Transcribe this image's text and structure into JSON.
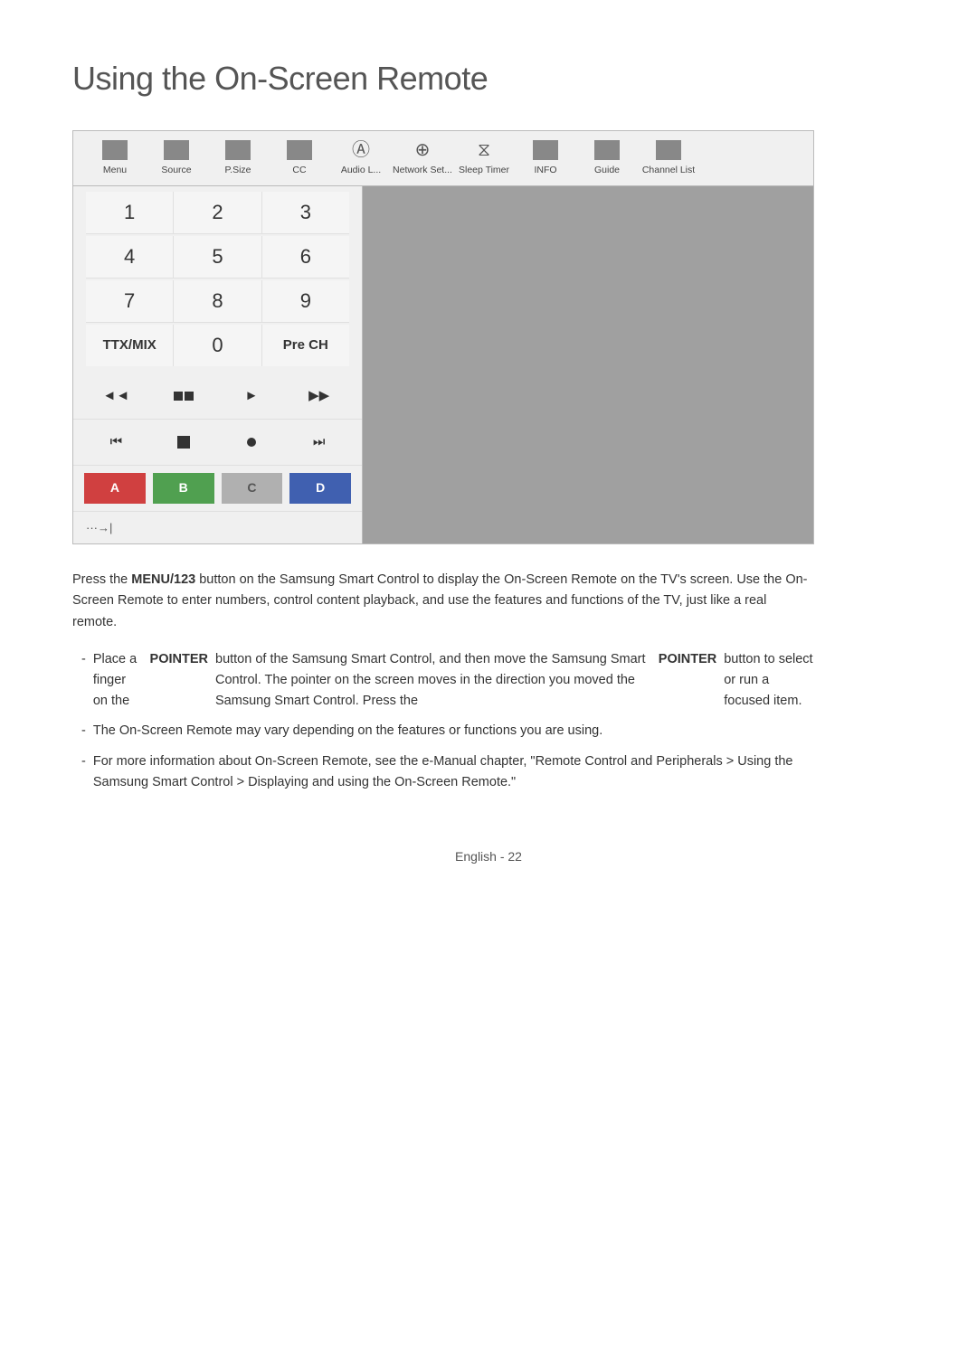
{
  "title": "Using the On-Screen Remote",
  "toolbar": {
    "items": [
      {
        "label": "Menu",
        "icon_type": "square"
      },
      {
        "label": "Source",
        "icon_type": "square"
      },
      {
        "label": "P.Size",
        "icon_type": "square"
      },
      {
        "label": "CC",
        "icon_type": "square"
      },
      {
        "label": "Audio L...",
        "icon_type": "letter_a"
      },
      {
        "label": "Network Set...",
        "icon_type": "globe"
      },
      {
        "label": "Sleep Timer",
        "icon_type": "clock"
      },
      {
        "label": "INFO",
        "icon_type": "square"
      },
      {
        "label": "Guide",
        "icon_type": "square"
      },
      {
        "label": "Channel List",
        "icon_type": "square"
      }
    ]
  },
  "numpad": {
    "rows": [
      [
        "1",
        "2",
        "3"
      ],
      [
        "4",
        "5",
        "6"
      ],
      [
        "7",
        "8",
        "9"
      ],
      [
        "TTX/MIX",
        "0",
        "Pre CH"
      ]
    ]
  },
  "transport_row1": [
    "◄◄",
    "▐▐",
    "►",
    "►►"
  ],
  "transport_row2": [
    "◄◄◄",
    "■",
    "●",
    "►►►"
  ],
  "color_buttons": [
    "A",
    "B",
    "C",
    "D"
  ],
  "nav_label": "···→|",
  "description": "Press the MENU/123 button on the Samsung Smart Control to display the On-Screen Remote on the TV's screen. Use the On-Screen Remote to enter numbers, control content playback, and use the features and functions of the TV, just like a real remote.",
  "bullets": [
    "Place a finger on the POINTER button of the Samsung Smart Control, and then move the Samsung Smart Control. The pointer on the screen moves in the direction you moved the Samsung Smart Control. Press the POINTER button to select or run a focused item.",
    "The On-Screen Remote may vary depending on the features or functions you are using.",
    "For more information about On-Screen Remote, see the e-Manual chapter, \"Remote Control and Peripherals > Using the Samsung Smart Control > Displaying and using the On-Screen Remote.\""
  ],
  "bold_words_desc": [
    "MENU/123"
  ],
  "bold_words_bullets": [
    "POINTER",
    "POINTER"
  ],
  "page_footer": "English - 22"
}
